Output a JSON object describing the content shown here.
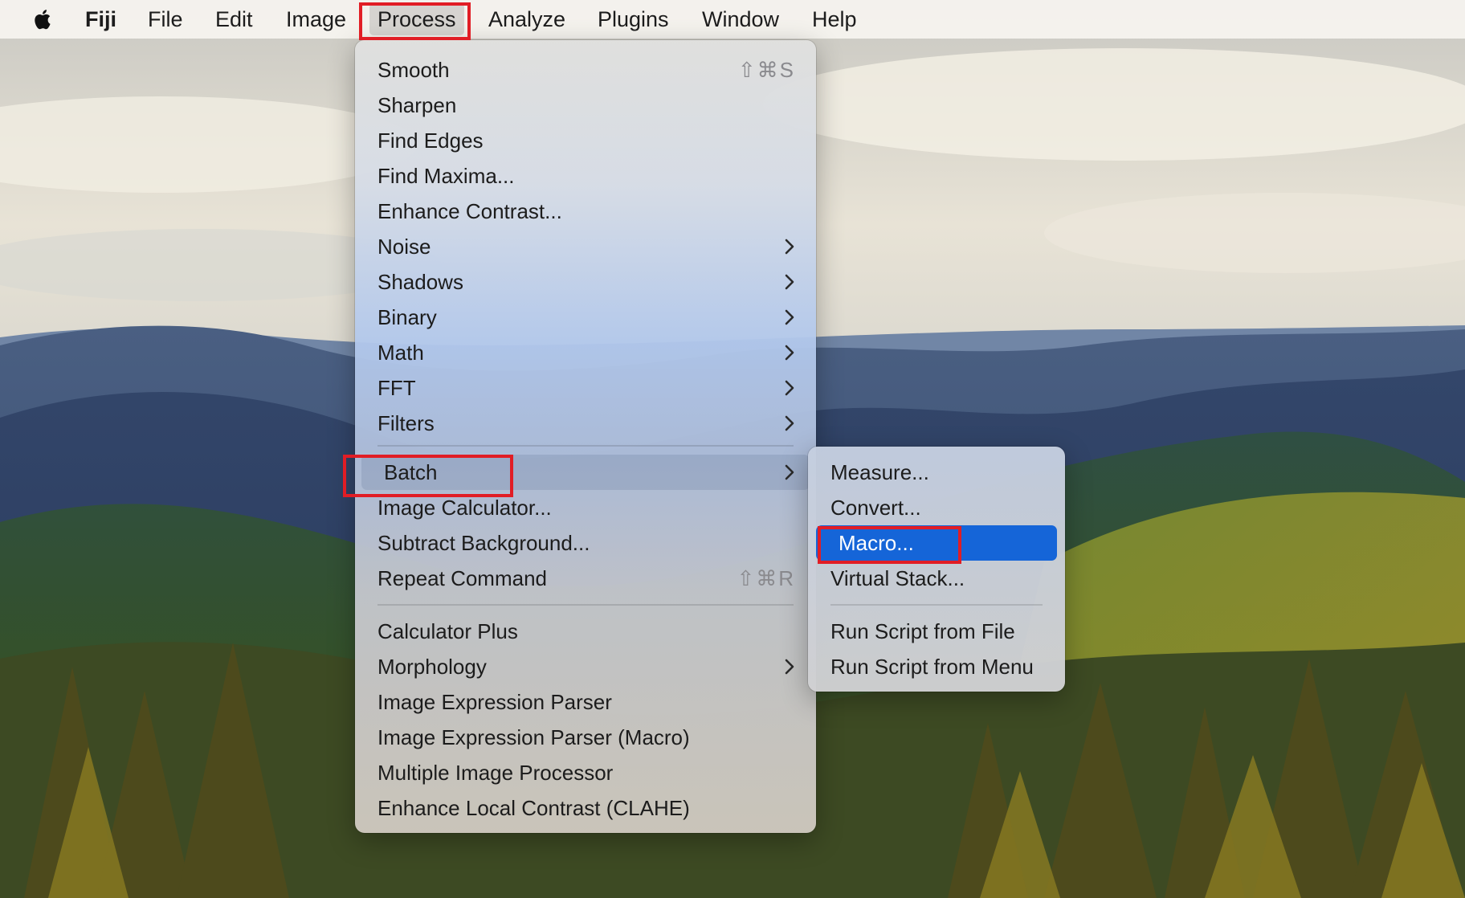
{
  "menubar": {
    "apple_icon": "apple-logo-icon",
    "app_name": "Fiji",
    "items": [
      "File",
      "Edit",
      "Image",
      "Process",
      "Analyze",
      "Plugins",
      "Window",
      "Help"
    ],
    "active_item": "Process"
  },
  "process_menu": {
    "items": [
      {
        "label": "Smooth",
        "shortcut": "⇧⌘S"
      },
      {
        "label": "Sharpen"
      },
      {
        "label": "Find Edges"
      },
      {
        "label": "Find Maxima..."
      },
      {
        "label": "Enhance Contrast..."
      },
      {
        "label": "Noise",
        "submenu": true
      },
      {
        "label": "Shadows",
        "submenu": true
      },
      {
        "label": "Binary",
        "submenu": true
      },
      {
        "label": "Math",
        "submenu": true
      },
      {
        "label": "FFT",
        "submenu": true
      },
      {
        "label": "Filters",
        "submenu": true
      },
      {
        "label": "Batch",
        "submenu": true,
        "highlighted": true
      },
      {
        "label": "Image Calculator..."
      },
      {
        "label": "Subtract Background..."
      },
      {
        "label": "Repeat Command",
        "shortcut": "⇧⌘R"
      },
      {
        "label": "Calculator Plus"
      },
      {
        "label": "Morphology",
        "submenu": true
      },
      {
        "label": "Image Expression Parser"
      },
      {
        "label": "Image Expression Parser (Macro)"
      },
      {
        "label": "Multiple Image Processor"
      },
      {
        "label": "Enhance Local Contrast (CLAHE)"
      }
    ]
  },
  "batch_submenu": {
    "items": [
      {
        "label": "Measure..."
      },
      {
        "label": "Convert..."
      },
      {
        "label": "Macro...",
        "selected": true
      },
      {
        "label": "Virtual Stack..."
      },
      {
        "label": "Run Script from File"
      },
      {
        "label": "Run Script from Menu"
      }
    ]
  },
  "colors": {
    "selection_blue": "#1565d8",
    "annotation_red": "#e11d25"
  }
}
